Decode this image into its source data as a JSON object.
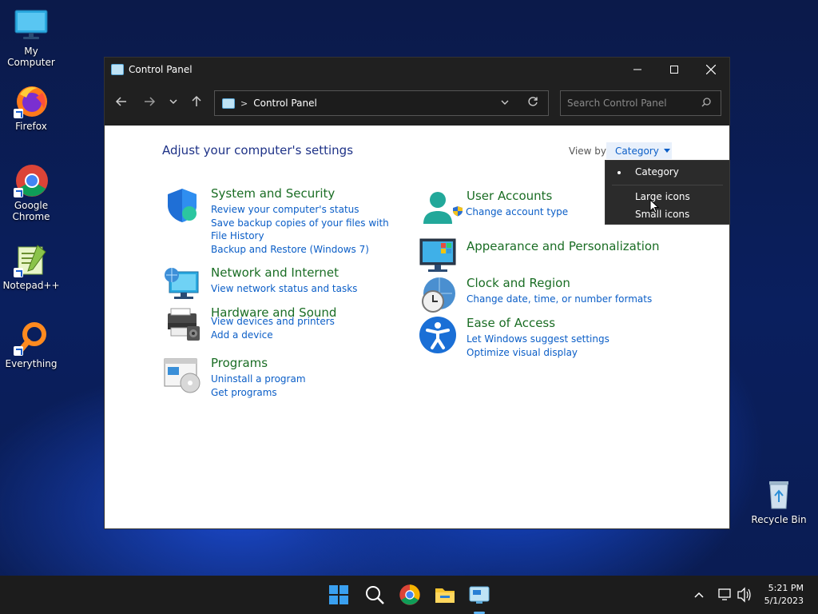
{
  "desktop": {
    "icons": [
      {
        "label": "My Computer"
      },
      {
        "label": "Firefox"
      },
      {
        "label": "Google Chrome"
      },
      {
        "label": "Notepad++"
      },
      {
        "label": "Everything"
      },
      {
        "label": "Recycle Bin"
      }
    ]
  },
  "window": {
    "title": "Control Panel",
    "address": "Control Panel",
    "search_placeholder": "Search Control Panel"
  },
  "content": {
    "heading": "Adjust your computer's settings",
    "view_by_label": "View by:",
    "view_by_value": "Category",
    "categories": [
      {
        "title": "System and Security",
        "links": [
          "Review your computer's status",
          "Save backup copies of your files with File History",
          "Backup and Restore (Windows 7)"
        ]
      },
      {
        "title": "Network and Internet",
        "links": [
          "View network status and tasks"
        ]
      },
      {
        "title": "Hardware and Sound",
        "links": [
          "View devices and printers",
          "Add a device"
        ]
      },
      {
        "title": "Programs",
        "links": [
          "Uninstall a program",
          "Get programs"
        ]
      },
      {
        "title": "User Accounts",
        "links": [
          "Change account type"
        ]
      },
      {
        "title": "Appearance and Personalization",
        "links": []
      },
      {
        "title": "Clock and Region",
        "links": [
          "Change date, time, or number formats"
        ]
      },
      {
        "title": "Ease of Access",
        "links": [
          "Let Windows suggest settings",
          "Optimize visual display"
        ]
      }
    ]
  },
  "dropdown": {
    "options": [
      "Category",
      "Large icons",
      "Small icons"
    ],
    "selected": "Category"
  },
  "taskbar": {
    "time": "5:21 PM",
    "date": "5/1/2023"
  },
  "colors": {
    "link": "#0b5ec7",
    "category_title": "#1a6d24",
    "heading": "#1e3287",
    "titlebar": "#202020",
    "taskbar": "#1c1c1c"
  }
}
